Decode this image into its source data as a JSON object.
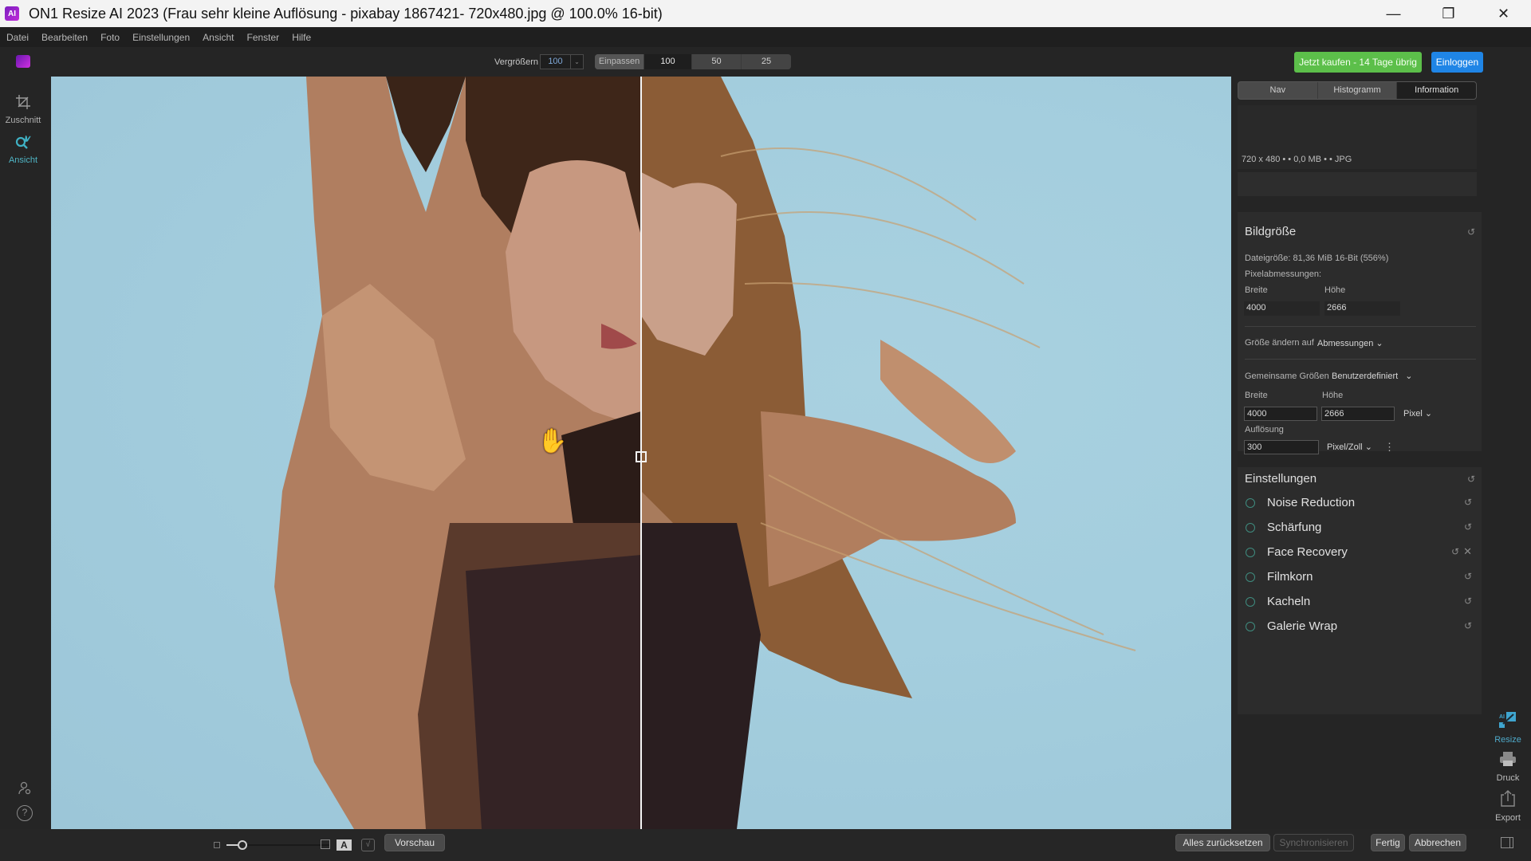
{
  "window": {
    "title": "ON1 Resize AI 2023 (Frau sehr kleine Auflösung - pixabay 1867421- 720x480.jpg @ 100.0% 16-bit)",
    "app_icon": "on1-resize-logo",
    "controls": {
      "minimize": "—",
      "maximize": "❐",
      "close": "✕"
    }
  },
  "menu": [
    "Datei",
    "Bearbeiten",
    "Foto",
    "Einstellungen",
    "Ansicht",
    "Fenster",
    "Hilfe"
  ],
  "toolbar": {
    "zoom_label": "Vergrößern",
    "zoom_value": "100",
    "zoom_dropdown_icon": "⌄",
    "fit_label": "Einpassen",
    "zoom_presets": [
      "100",
      "50",
      "25"
    ],
    "active_preset": "100",
    "buy_label": "Jetzt kaufen - 14 Tage übrig",
    "login_label": "Einloggen"
  },
  "left_tools": [
    {
      "label": "Zuschnitt",
      "icon": "crop-icon",
      "glyph": "⟀"
    },
    {
      "label": "Ansicht",
      "icon": "view-hand-icon",
      "glyph": "🔍"
    }
  ],
  "left_bottom_icons": [
    {
      "icon": "user-settings-icon",
      "glyph": "⚇"
    },
    {
      "icon": "help-icon",
      "glyph": "?"
    },
    {
      "icon": "panel-toggle-icon",
      "glyph": "▯"
    }
  ],
  "panel": {
    "tabs": [
      "Nav",
      "Histogramm",
      "Information"
    ],
    "active_tab": "Information",
    "info_line": "720 x 480 • • 0,0 MB • • JPG",
    "bildgroesse": {
      "title": "Bildgröße",
      "filesize": "Dateigröße: 81,36 MiB 16-Bit (556%)",
      "pixel_label": "Pixelabmessungen:",
      "width_label": "Breite",
      "height_label": "Höhe",
      "width_value": "4000",
      "height_value": "2666",
      "resize_to_label": "Größe ändern auf",
      "resize_to_value": "Abmessungen",
      "common_sizes_label": "Gemeinsame Größen",
      "common_sizes_value": "Benutzerdefiniert",
      "custom_width_label": "Breite",
      "custom_height_label": "Höhe",
      "custom_width": "4000",
      "custom_height": "2666",
      "unit": "Pixel",
      "resolution_label": "Auflösung",
      "resolution_value": "300",
      "resolution_unit": "Pixel/Zoll",
      "chevron": "⌄",
      "more_icon": "⋮"
    },
    "einstellungen": {
      "title": "Einstellungen",
      "items": [
        "Noise Reduction",
        "Schärfung",
        "Face Recovery",
        "Filmkorn",
        "Kacheln",
        "Galerie Wrap"
      ]
    },
    "reset_glyph": "↺",
    "close_glyph": "✕"
  },
  "right_tools": [
    {
      "label": "Resize",
      "icon": "ai-resize-icon",
      "glyph": "⤢"
    },
    {
      "label": "Druck",
      "icon": "print-icon",
      "glyph": "⎙"
    },
    {
      "label": "Export",
      "icon": "export-icon",
      "glyph": "⇪"
    }
  ],
  "bottom": {
    "preview_label": "Vorschau",
    "reset_all_label": "Alles zurücksetzen",
    "sync_label": "Synchronisieren",
    "done_label": "Fertig",
    "cancel_label": "Abbrechen",
    "slider_value": 0.15
  },
  "canvas": {
    "cursor": "✋",
    "split_position": 0.5
  }
}
